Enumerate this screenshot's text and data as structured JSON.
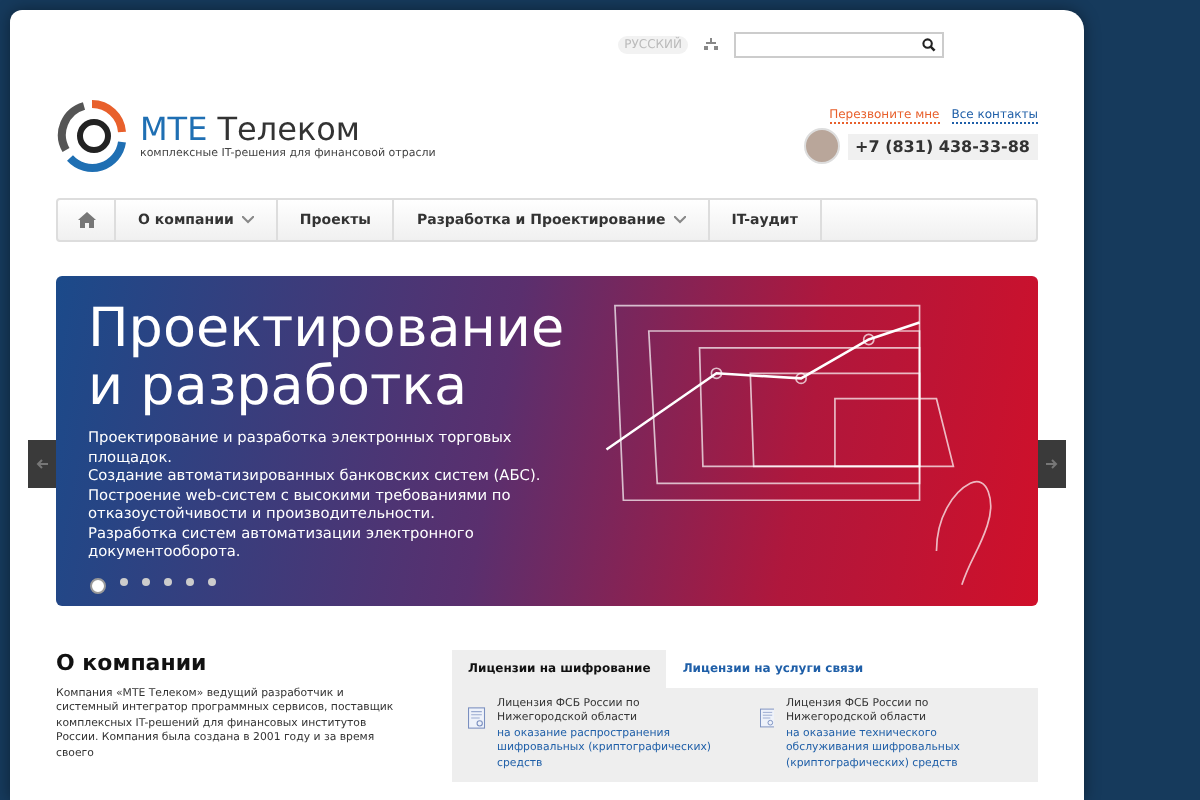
{
  "top_bar": {
    "language": "РУССКИЙ"
  },
  "logo": {
    "name_accent": "МТЕ",
    "name": "Телеком",
    "tagline": "комплексные IT-решения для финансовой отрасли"
  },
  "contacts": {
    "callback": "Перезвоните мне",
    "all": "Все контакты",
    "phone": "+7 (831) 438-33-88"
  },
  "nav": [
    {
      "label": "О компании",
      "has_submenu": true
    },
    {
      "label": "Проекты",
      "has_submenu": false
    },
    {
      "label": "Разработка и Проектирование",
      "has_submenu": true
    },
    {
      "label": "IT-аудит",
      "has_submenu": false
    }
  ],
  "banner": {
    "title": "Проектирование и разработка",
    "lines": [
      "Проектирование и разработка электронных торговых площадок.",
      "Создание автоматизированных банковских систем (АБС).",
      "Построение web-систем с высокими требованиями по отказоустойчивости и производительности.",
      "Разработка систем автоматизации электронного документооборота."
    ],
    "dots": [
      {
        "selected": true
      },
      {
        "selected": false
      },
      {
        "selected": false
      },
      {
        "selected": false
      },
      {
        "selected": false
      },
      {
        "selected": false
      }
    ]
  },
  "about": {
    "title": "О компании",
    "text": "Компания «МТЕ Телеком» ведущий разработчик и системный интегратор программных сервисов, поставщик комплексных IT-решений для финансовых институтов России. Компания была создана в 2001 году и за время своего"
  },
  "licenses": {
    "tabs": [
      {
        "label": "Лицензии на шифрование",
        "selected": true
      },
      {
        "label": "Лицензии на услуги связи",
        "selected": false
      }
    ],
    "items": [
      {
        "text": "Лицензия ФСБ России по Нижегородской области",
        "link": "на оказание распространения шифровальных (криптографических) средств"
      },
      {
        "text": "Лицензия ФСБ России по Нижегородской области",
        "link": "на оказание технического обслуживания шифровальных (криптографических) средств"
      }
    ]
  }
}
